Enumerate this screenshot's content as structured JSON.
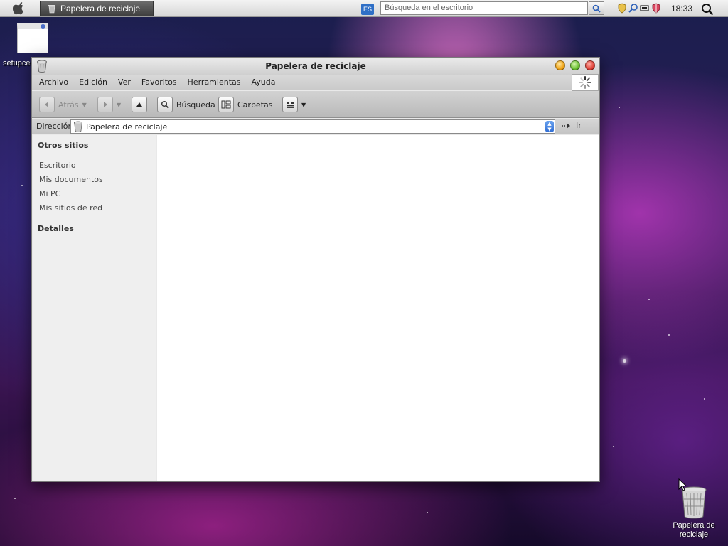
{
  "taskbar": {
    "active_window": "Papelera de reciclaje",
    "language": "ES",
    "search_placeholder": "Búsqueda en el escritorio",
    "clock": "18:33"
  },
  "desktop": {
    "icon1_label": "setupcer",
    "trash_label_line1": "Papelera de",
    "trash_label_line2": "reciclaje"
  },
  "window": {
    "title": "Papelera de reciclaje",
    "menu": [
      "Archivo",
      "Edición",
      "Ver",
      "Favoritos",
      "Herramientas",
      "Ayuda"
    ],
    "toolbar": {
      "back": "Atrás",
      "search": "Búsqueda",
      "folders": "Carpetas"
    },
    "address": {
      "label": "Dirección",
      "value": "Papelera de reciclaje",
      "go": "Ir"
    },
    "sidebar": {
      "other_places_title": "Otros sitios",
      "links": [
        "Escritorio",
        "Mis documentos",
        "Mi PC",
        "Mis sitios de red"
      ],
      "details_title": "Detalles"
    }
  }
}
